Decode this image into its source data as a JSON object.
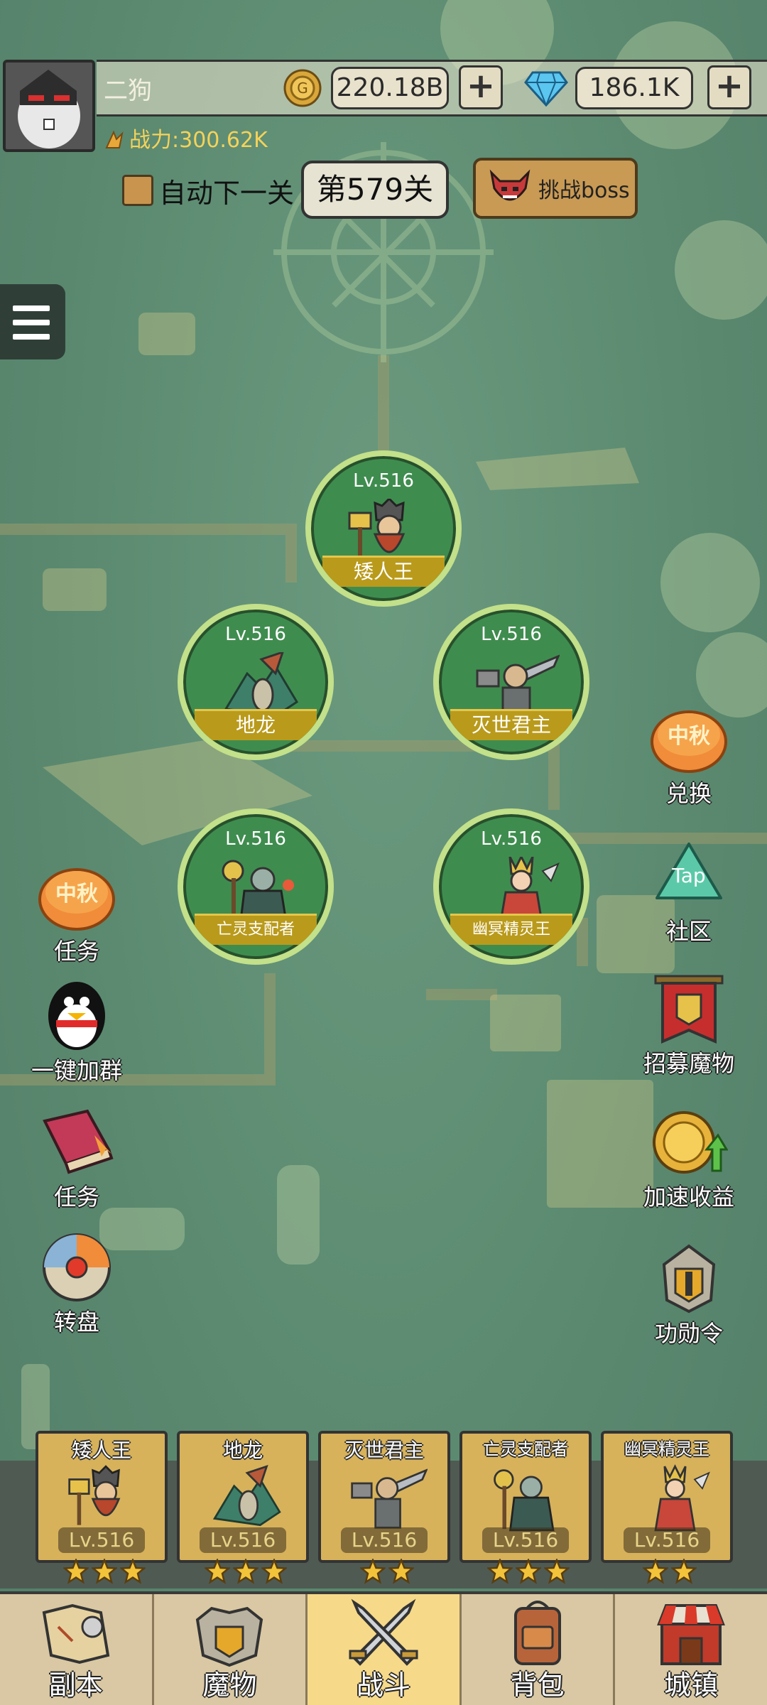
{
  "player": {
    "name": "二狗",
    "power_label": "战力:300.62K"
  },
  "currency": {
    "gold": "220.18B",
    "gems": "186.1K",
    "plus": "+"
  },
  "stage": {
    "auto_next_label": "自动下一关",
    "stage_label": "第579关",
    "boss_label": "挑战boss"
  },
  "formation": [
    {
      "level": "Lv.516",
      "name": "矮人王"
    },
    {
      "level": "Lv.516",
      "name": "地龙"
    },
    {
      "level": "Lv.516",
      "name": "灭世君主"
    },
    {
      "level": "Lv.516",
      "name": "亡灵支配者"
    },
    {
      "level": "Lv.516",
      "name": "幽冥精灵王"
    }
  ],
  "left_buttons": [
    {
      "label": "任务",
      "icon": "mooncake-icon",
      "badge": "中秋"
    },
    {
      "label": "一键加群",
      "icon": "penguin-icon"
    },
    {
      "label": "任务",
      "icon": "task-book-icon"
    },
    {
      "label": "转盘",
      "icon": "wheel-icon"
    }
  ],
  "right_buttons": [
    {
      "label": "兑换",
      "icon": "mooncake-icon",
      "badge": "中秋"
    },
    {
      "label": "社区",
      "icon": "tap-community-icon",
      "badge": "Tap"
    },
    {
      "label": "招募魔物",
      "icon": "recruit-banner-icon"
    },
    {
      "label": "加速收益",
      "icon": "speed-coin-icon"
    },
    {
      "label": "功勋令",
      "icon": "helmet-icon"
    }
  ],
  "team": [
    {
      "name": "矮人王",
      "level": "Lv.516",
      "stars": 3
    },
    {
      "name": "地龙",
      "level": "Lv.516",
      "stars": 3
    },
    {
      "name": "灭世君主",
      "level": "Lv.516",
      "stars": 2
    },
    {
      "name": "亡灵支配者",
      "level": "Lv.516",
      "stars": 3
    },
    {
      "name": "幽冥精灵王",
      "level": "Lv.516",
      "stars": 2
    }
  ],
  "nav": [
    {
      "label": "副本",
      "icon": "map-scroll-icon",
      "active": false
    },
    {
      "label": "魔物",
      "icon": "monster-helmet-icon",
      "active": false
    },
    {
      "label": "战斗",
      "icon": "crossed-swords-icon",
      "active": true
    },
    {
      "label": "背包",
      "icon": "backpack-icon",
      "active": false
    },
    {
      "label": "城镇",
      "icon": "town-shop-icon",
      "active": false
    }
  ],
  "colors": {
    "map_green": "#5d8c73",
    "circle_green": "#3f8c4f",
    "banner_gold": "#b99a1b",
    "nav_active": "#f6d989",
    "power_yellow": "#f5d25a"
  }
}
